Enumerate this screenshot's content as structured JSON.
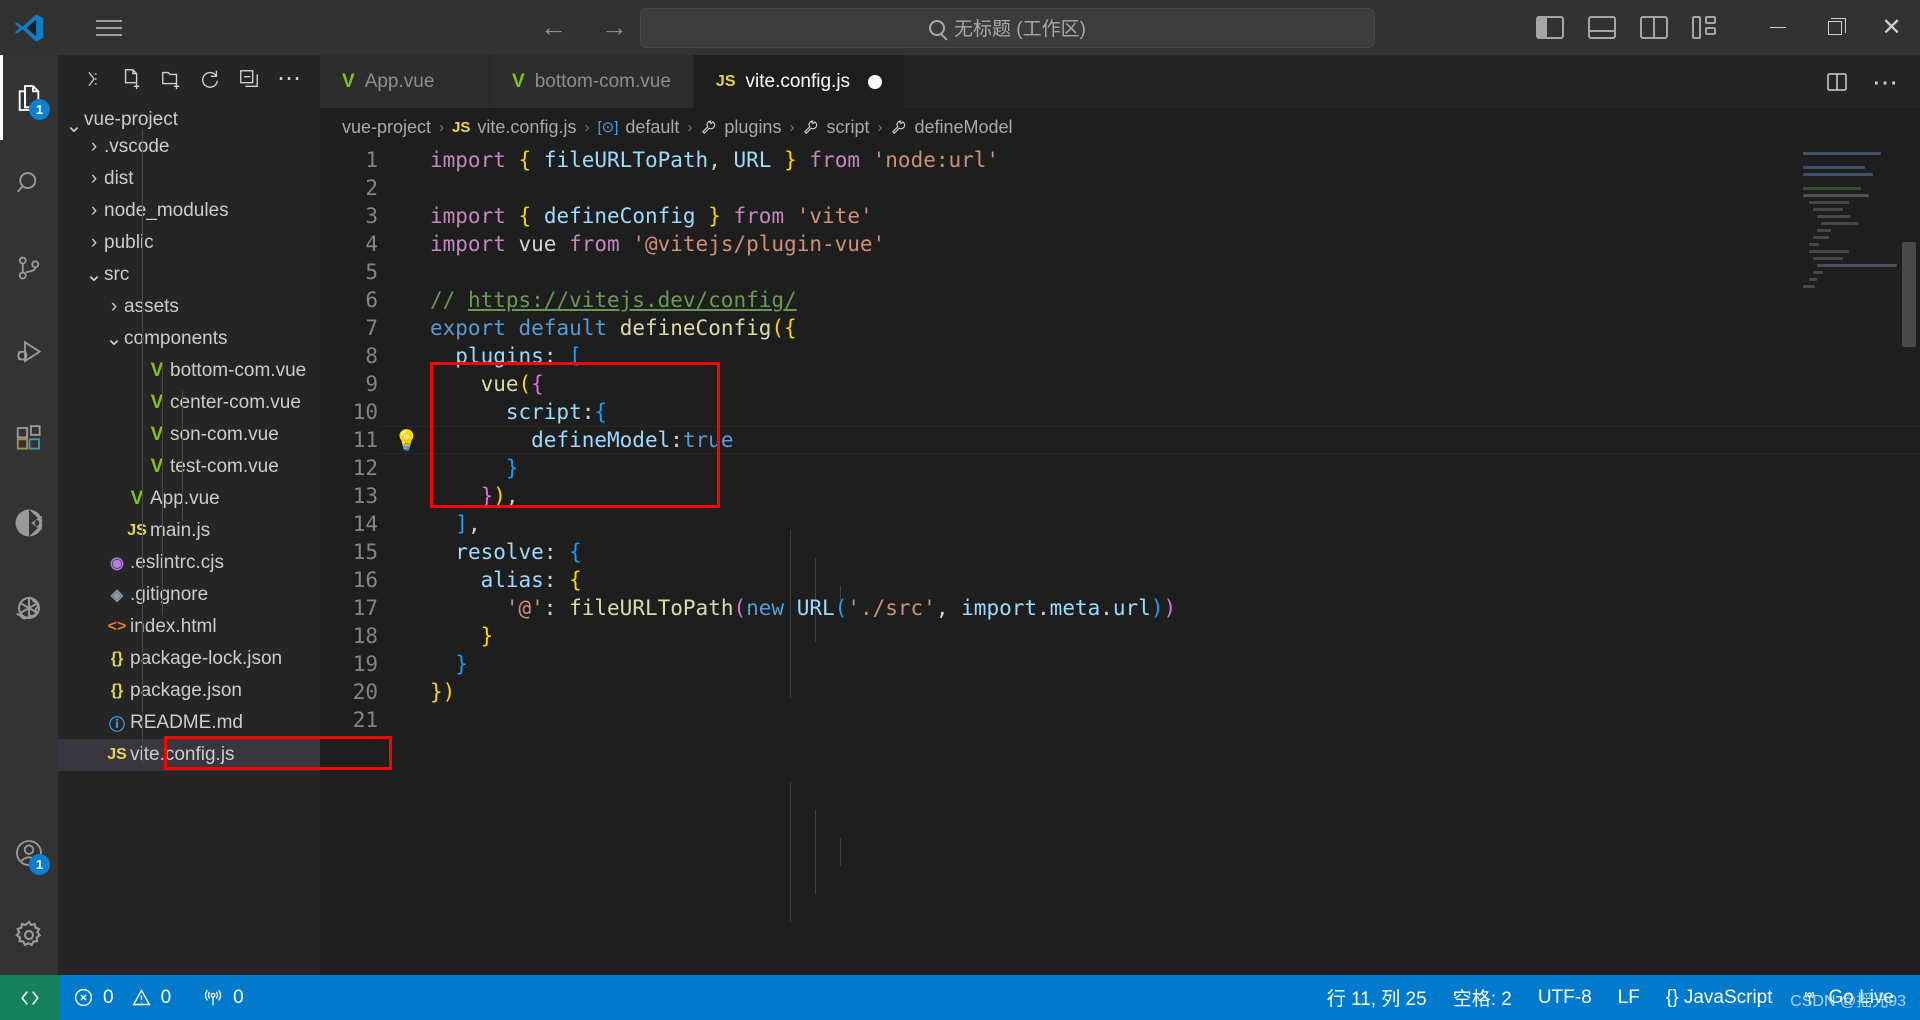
{
  "titlebar": {
    "logo_icon": "vscode-logo-icon",
    "menu_icon": "hamburger-menu-icon",
    "back_icon": "arrow-left-icon",
    "forward_icon": "arrow-right-icon",
    "search": {
      "icon": "search-icon",
      "value": "无标题 (工作区)"
    },
    "layout_icons": [
      "toggle-primary-sidebar-icon",
      "toggle-panel-icon",
      "toggle-secondary-sidebar-icon",
      "customize-layout-icon"
    ],
    "window": {
      "minimize": "minimize-icon",
      "maximize": "maximize-icon",
      "close": "close-icon"
    }
  },
  "activitybar": {
    "items": [
      {
        "name": "explorer",
        "icon": "files-icon",
        "badge": "1",
        "active": true
      },
      {
        "name": "search",
        "icon": "search-icon",
        "badge": "",
        "active": false
      },
      {
        "name": "source-control",
        "icon": "source-control-icon",
        "badge": "",
        "active": false
      },
      {
        "name": "run-and-debug",
        "icon": "run-debug-icon",
        "badge": "",
        "active": false
      },
      {
        "name": "extensions",
        "icon": "extensions-icon",
        "badge": "",
        "active": false
      },
      {
        "name": "codegeex",
        "icon": "codegeex-icon",
        "badge": "",
        "active": false
      },
      {
        "name": "chatgpt",
        "icon": "openai-icon",
        "badge": "",
        "active": false
      }
    ],
    "bottom": [
      {
        "name": "accounts",
        "icon": "account-icon",
        "badge": "1"
      },
      {
        "name": "manage",
        "icon": "gear-icon",
        "badge": ""
      }
    ]
  },
  "sidebar": {
    "actions": [
      {
        "name": "collapse-folders-icon",
        "glyph": "collapse"
      },
      {
        "name": "new-file-icon",
        "glyph": "new-file"
      },
      {
        "name": "new-folder-icon",
        "glyph": "new-folder"
      },
      {
        "name": "refresh-icon",
        "glyph": "refresh"
      },
      {
        "name": "collapse-all-icon",
        "glyph": "collapse-all"
      },
      {
        "name": "more-actions-icon",
        "glyph": "..."
      }
    ],
    "tree": [
      {
        "label": "vue-project",
        "depth": 0,
        "type": "folder",
        "expanded": true,
        "icon": "",
        "icon_color": "",
        "clipped": true
      },
      {
        "label": ".vscode",
        "depth": 1,
        "type": "folder",
        "expanded": false,
        "icon": "",
        "icon_color": ""
      },
      {
        "label": "dist",
        "depth": 1,
        "type": "folder",
        "expanded": false,
        "icon": "",
        "icon_color": ""
      },
      {
        "label": "node_modules",
        "depth": 1,
        "type": "folder",
        "expanded": false,
        "icon": "",
        "icon_color": ""
      },
      {
        "label": "public",
        "depth": 1,
        "type": "folder",
        "expanded": false,
        "icon": "",
        "icon_color": ""
      },
      {
        "label": "src",
        "depth": 1,
        "type": "folder",
        "expanded": true,
        "icon": "",
        "icon_color": ""
      },
      {
        "label": "assets",
        "depth": 2,
        "type": "folder",
        "expanded": false,
        "icon": "",
        "icon_color": ""
      },
      {
        "label": "components",
        "depth": 2,
        "type": "folder",
        "expanded": true,
        "icon": "",
        "icon_color": ""
      },
      {
        "label": "bottom-com.vue",
        "depth": 3,
        "type": "file",
        "icon": "V",
        "icon_color": "#7fc41b"
      },
      {
        "label": "center-com.vue",
        "depth": 3,
        "type": "file",
        "icon": "V",
        "icon_color": "#7fc41b"
      },
      {
        "label": "son-com.vue",
        "depth": 3,
        "type": "file",
        "icon": "V",
        "icon_color": "#7fc41b"
      },
      {
        "label": "test-com.vue",
        "depth": 3,
        "type": "file",
        "icon": "V",
        "icon_color": "#7fc41b"
      },
      {
        "label": "App.vue",
        "depth": 2,
        "type": "file",
        "icon": "V",
        "icon_color": "#7fc41b"
      },
      {
        "label": "main.js",
        "depth": 2,
        "type": "file",
        "icon": "JS",
        "icon_color": "#e8d44d"
      },
      {
        "label": ".eslintrc.cjs",
        "depth": 1,
        "type": "file",
        "icon": "◉",
        "icon_color": "#b57edc"
      },
      {
        "label": ".gitignore",
        "depth": 1,
        "type": "file",
        "icon": "◈",
        "icon_color": "#8a9aa0"
      },
      {
        "label": "index.html",
        "depth": 1,
        "type": "file",
        "icon": "<>",
        "icon_color": "#e8762c"
      },
      {
        "label": "package-lock.json",
        "depth": 1,
        "type": "file",
        "icon": "{}",
        "icon_color": "#e8d44d"
      },
      {
        "label": "package.json",
        "depth": 1,
        "type": "file",
        "icon": "{}",
        "icon_color": "#e8d44d"
      },
      {
        "label": "README.md",
        "depth": 1,
        "type": "file",
        "icon": "ⓘ",
        "icon_color": "#42a5f5"
      },
      {
        "label": "vite.config.js",
        "depth": 1,
        "type": "file",
        "icon": "JS",
        "icon_color": "#e8d44d",
        "selected": true,
        "highlighted": true
      }
    ]
  },
  "editor": {
    "tabs": [
      {
        "label": "App.vue",
        "icon": "V",
        "icon_color": "#7fc41b",
        "active": false,
        "dirty": false
      },
      {
        "label": "bottom-com.vue",
        "icon": "V",
        "icon_color": "#7fc41b",
        "active": false,
        "dirty": false
      },
      {
        "label": "vite.config.js",
        "icon": "JS",
        "icon_color": "#e8d44d",
        "active": true,
        "dirty": true
      }
    ],
    "tab_actions": [
      {
        "name": "split-editor-icon"
      },
      {
        "name": "more-actions-icon"
      }
    ],
    "breadcrumb": [
      {
        "label": "vue-project",
        "icon": ""
      },
      {
        "label": "vite.config.js",
        "icon": "JS"
      },
      {
        "label": "default",
        "icon": "module"
      },
      {
        "label": "plugins",
        "icon": "property"
      },
      {
        "label": "script",
        "icon": "property"
      },
      {
        "label": "defineModel",
        "icon": "property"
      }
    ],
    "lines": [
      {
        "n": "1",
        "html": "<span class='k-import'>import</span> <span class='k-pl'>{</span> <span class='k-var'>fileURLToPath</span>, <span class='k-var'>URL</span> <span class='k-pl'>}</span> <span class='k-import'>from</span> <span class='k-str'>'node:url'</span>"
      },
      {
        "n": "2",
        "html": ""
      },
      {
        "n": "3",
        "html": "<span class='k-import'>import</span> <span class='k-pl'>{</span> <span class='k-var'>defineConfig</span> <span class='k-pl'>}</span> <span class='k-import'>from</span> <span class='k-str'>'vite'</span>"
      },
      {
        "n": "4",
        "html": "<span class='k-import'>import</span> <span class='k-def'>vue</span> <span class='k-import'>from</span> <span class='k-str'>'@vitejs/plugin-vue'</span>"
      },
      {
        "n": "5",
        "html": ""
      },
      {
        "n": "6",
        "html": "<span class='k-com'>// </span><span class='k-lnk'>https://vitejs.dev/config/</span>"
      },
      {
        "n": "7",
        "html": "<span class='k-kw'>export</span> <span class='k-kw'>default</span> <span class='k-fn'>defineConfig</span><span class='k-pl'>({</span>"
      },
      {
        "n": "8",
        "html": "  <span class='k-prop'>plugins</span><span class='k-def'>:</span> <span class='k-pl3'>[</span>"
      },
      {
        "n": "9",
        "html": "    <span class='k-fn'>vue</span><span class='k-pl'>(</span><span class='k-pl2'>{</span>"
      },
      {
        "n": "10",
        "html": "      <span class='k-prop'>script</span><span class='k-def'>:</span><span class='k-pl3'>{</span>"
      },
      {
        "n": "11",
        "html": "        <span class='k-prop'>defineModel</span><span class='k-def'>:</span><span class='k-kw'>true</span>",
        "current": true,
        "bulb": true
      },
      {
        "n": "12",
        "html": "      <span class='k-pl3'>}</span>"
      },
      {
        "n": "13",
        "html": "    <span class='k-pl2'>}</span><span class='k-pl'>)</span><span class='k-def'>,</span>"
      },
      {
        "n": "14",
        "html": "  <span class='k-pl3'>]</span><span class='k-def'>,</span>"
      },
      {
        "n": "15",
        "html": "  <span class='k-prop'>resolve</span><span class='k-def'>:</span> <span class='k-pl3'>{</span>"
      },
      {
        "n": "16",
        "html": "    <span class='k-prop'>alias</span><span class='k-def'>:</span> <span class='k-pl'>{</span>"
      },
      {
        "n": "17",
        "html": "      <span class='k-str'>'@'</span><span class='k-def'>:</span> <span class='k-fn'>fileURLToPath</span><span class='k-pl2'>(</span><span class='k-kw'>new</span> <span class='k-var'>URL</span><span class='k-pl3'>(</span><span class='k-str'>'./src'</span><span class='k-def'>,</span> <span class='k-var'>import</span><span class='k-def'>.</span><span class='k-var'>meta</span><span class='k-def'>.</span><span class='k-var'>url</span><span class='k-pl3'>)</span><span class='k-pl2'>)</span>"
      },
      {
        "n": "18",
        "html": "    <span class='k-pl'>}</span>"
      },
      {
        "n": "19",
        "html": "  <span class='k-pl3'>}</span>"
      },
      {
        "n": "20",
        "html": "<span class='k-pl'>})</span>"
      },
      {
        "n": "21",
        "html": ""
      }
    ],
    "annotation_box_label": "highlight-box-vue-plugin-script-block"
  },
  "statusbar": {
    "remote_icon": "remote-window-icon",
    "left": [
      {
        "name": "problems-errors",
        "icon": "error-icon",
        "text": "0"
      },
      {
        "name": "problems-warnings",
        "icon": "warning-icon",
        "text": "0"
      },
      {
        "name": "ports",
        "icon": "radio-tower-icon",
        "text": "0"
      }
    ],
    "right": [
      {
        "name": "editor-position",
        "text": "行 11, 列 25"
      },
      {
        "name": "indentation",
        "text": "空格: 2"
      },
      {
        "name": "encoding",
        "text": "UTF-8"
      },
      {
        "name": "eol",
        "text": "LF"
      },
      {
        "name": "language-mode",
        "text": "{} JavaScript"
      },
      {
        "name": "go-live",
        "text": "Go Live"
      }
    ],
    "watermark": "CSDN @摇光93"
  },
  "colors": {
    "accent": "#007acc",
    "remote_green": "#16825d",
    "annotation_red": "#ff0000",
    "badge_blue": "#0a7fd4"
  }
}
